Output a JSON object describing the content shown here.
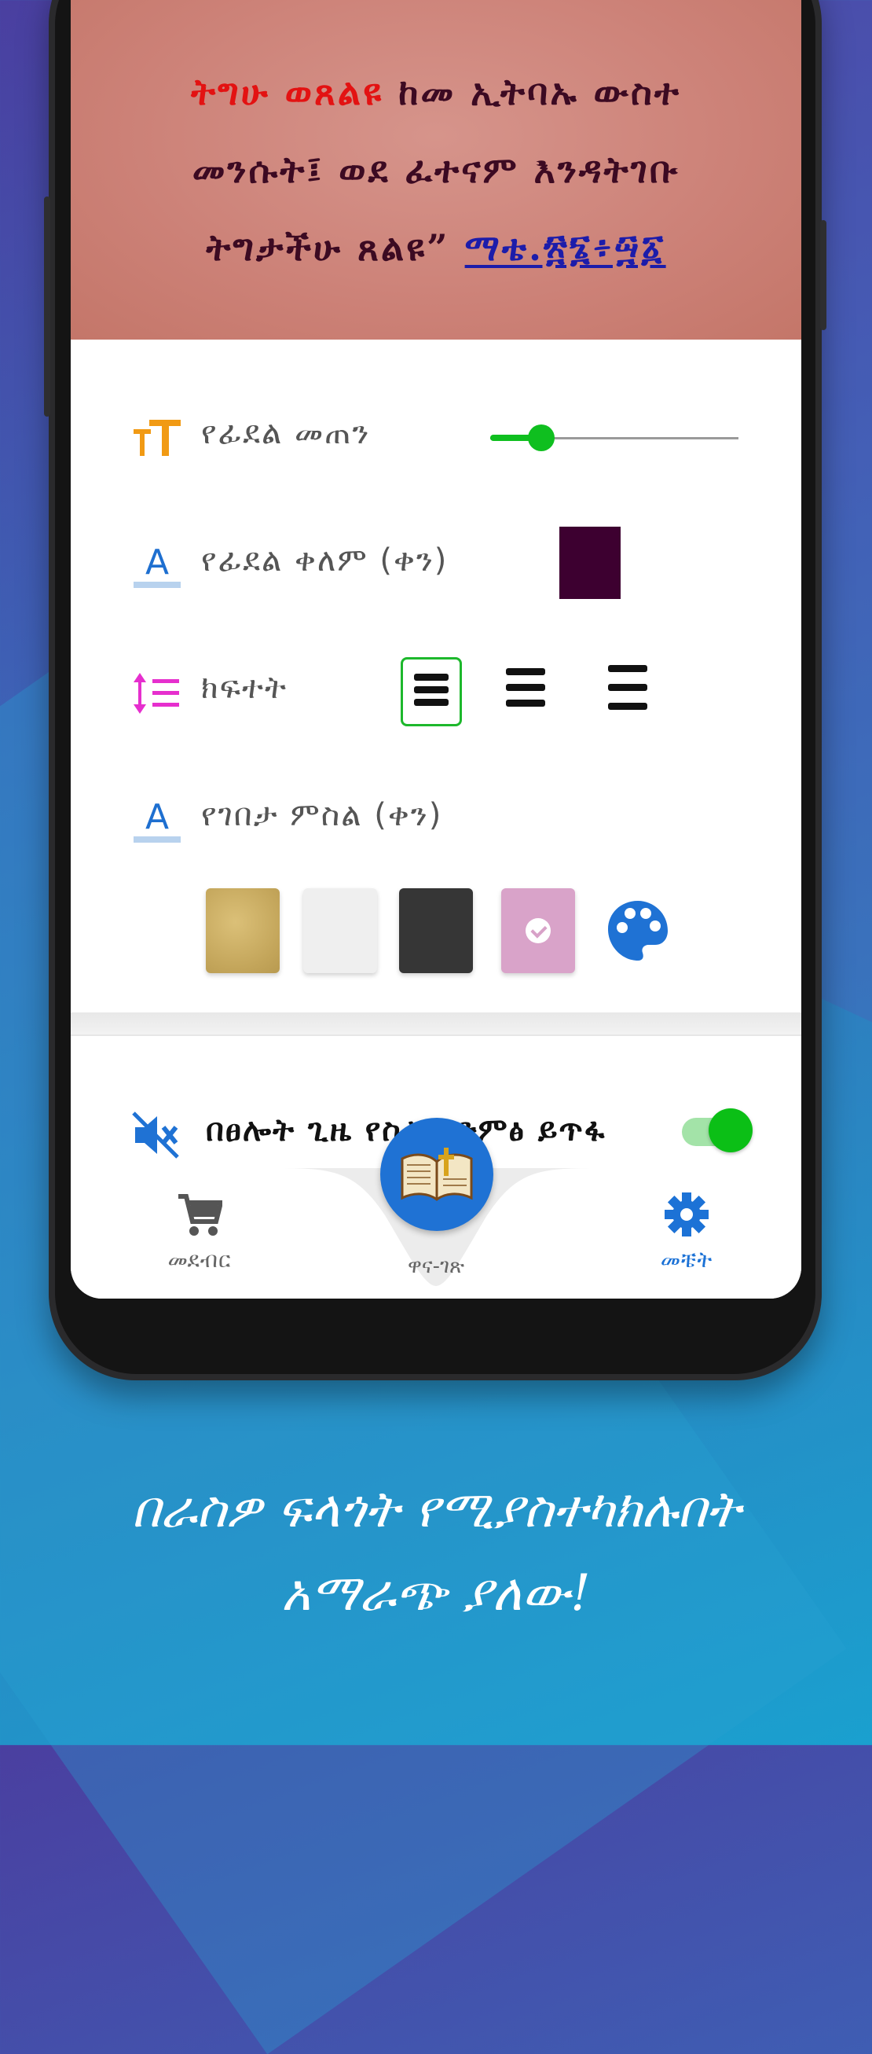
{
  "quote": {
    "highlight": "ትግሁ ወጸልዩ",
    "body": "ከመ ኢትባኡ ውስተ መንሱት፤ ወደ ፈተናም እንዳትገቡ ትግታችሁ ጸልዩ”",
    "reference": "ማቴ.፳፮፥፵፩"
  },
  "settings": {
    "font_size": {
      "label": "የፊደል መጠን",
      "value_fraction": 0.17
    },
    "font_color": {
      "label": "የፊደል ቀለም (ቀን)",
      "color": "#3d0030"
    },
    "line_spacing": {
      "label": "ክፍተት",
      "options": [
        "compact",
        "normal",
        "wide"
      ],
      "selected": "compact"
    },
    "background": {
      "label": "የገበታ ምስል (ቀን)",
      "swatches": [
        {
          "name": "gold-texture",
          "color": "#c9ad62"
        },
        {
          "name": "light-gray",
          "color": "#efefef"
        },
        {
          "name": "dark-gray",
          "color": "#363636"
        },
        {
          "name": "pink",
          "color": "#d9a3c9"
        }
      ],
      "selected": "pink",
      "custom_icon": "palette-icon"
    },
    "mute": {
      "label": "በፀሎት ጊዜ የስልክ ድምፅ ይጥፋ",
      "enabled": true
    }
  },
  "nav": {
    "items": [
      {
        "label": "መደብር",
        "icon": "cart-icon"
      },
      {
        "label": "ዋና-ገጽ",
        "icon": "bible-icon"
      },
      {
        "label": "መቼት",
        "icon": "gear-icon"
      }
    ],
    "active": "መቼት"
  },
  "caption": {
    "line1": "በራስዎ ፍላጎት የሚያስተካክሉበት",
    "line2": "አማራጭ ያለው!"
  },
  "colors": {
    "accent": "#1f72d4",
    "toggle": "#0bbf16"
  }
}
